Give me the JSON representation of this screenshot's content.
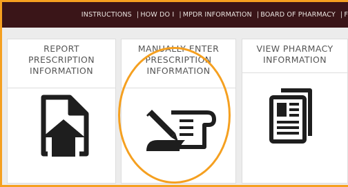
{
  "nav": {
    "items": [
      {
        "label": "INSTRUCTIONS"
      },
      {
        "label": "HOW DO I"
      },
      {
        "label": "MPDR INFORMATION"
      },
      {
        "label": "BOARD OF PHARMACY"
      },
      {
        "label": "F"
      }
    ],
    "separator": "|"
  },
  "tiles": [
    {
      "line1": "REPORT",
      "line2": "PRESCRIPTION",
      "line3": "INFORMATION",
      "icon": "upload-document-icon"
    },
    {
      "line1": "MANUALLY ENTER",
      "line2": "PRESCRIPTION",
      "line3": "INFORMATION",
      "icon": "edit-scroll-icon"
    },
    {
      "line1": "VIEW PHARMACY",
      "line2": "INFORMATION",
      "line3": "",
      "icon": "document-view-icon"
    }
  ],
  "colors": {
    "topbar": "#3a1518",
    "accent_orange": "#f5a020",
    "icon": "#1e1e1e",
    "label_text": "#555555"
  }
}
